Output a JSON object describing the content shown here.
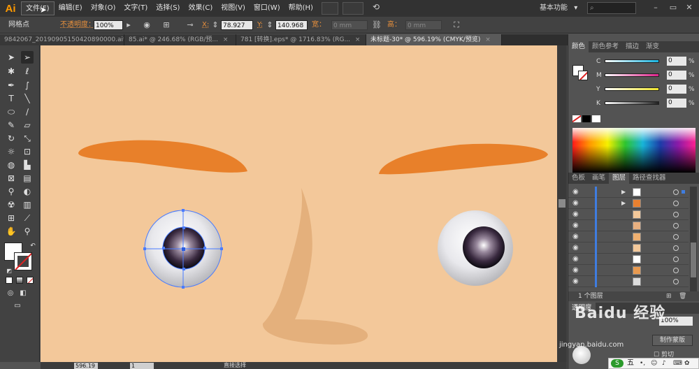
{
  "app": {
    "logo": "Ai"
  },
  "menu": {
    "items": [
      "文件(F)",
      "编辑(E)",
      "对象(O)",
      "文字(T)",
      "选择(S)",
      "效果(C)",
      "视图(V)",
      "窗口(W)",
      "帮助(H)"
    ],
    "workspace": "基本功能",
    "workspace_arrow": "▾"
  },
  "control": {
    "selection_label": "网格点",
    "opacity_label": "不透明度：",
    "opacity_value": "100%",
    "x_label": "X:",
    "x_value": "78.927",
    "y_label": "Y:",
    "y_value": "140.968",
    "width_label": "宽：",
    "width_value": "0 mm",
    "height_label": "高：",
    "height_value": "0 mm"
  },
  "tabs": [
    {
      "label": "9842067_20190905150420890000.ai*",
      "active": false
    },
    {
      "label": "85.ai* @ 246.68% (RGB/预...",
      "active": false
    },
    {
      "label": "781 [转换].eps* @ 1716.83% (RG...",
      "active": false
    },
    {
      "label": "未标题-30* @ 596.19% (CMYK/预览)",
      "active": true
    }
  ],
  "color_panel": {
    "tabs": [
      "颜色",
      "颜色参考",
      "描边",
      "渐变"
    ],
    "channels": [
      {
        "label": "C",
        "value": "0",
        "unit": "%",
        "color": "#19b5e0"
      },
      {
        "label": "M",
        "value": "0",
        "unit": "%",
        "color": "#e0238c"
      },
      {
        "label": "Y",
        "value": "0",
        "unit": "%",
        "color": "#f0e62d"
      },
      {
        "label": "K",
        "value": "0",
        "unit": "%",
        "color": "#222222"
      }
    ]
  },
  "layers_panel": {
    "tabs": [
      "色板",
      "画笔",
      "图层",
      "路径查找器"
    ],
    "count_label": "1 个图层",
    "rows": [
      {
        "arrow": "▶",
        "thumb": "#ffffff",
        "selected": true
      },
      {
        "arrow": "▶",
        "thumb": "#e88030",
        "selected": false
      },
      {
        "arrow": "",
        "thumb": "#f3c89a",
        "selected": false
      },
      {
        "arrow": "",
        "thumb": "#e8b080",
        "selected": false
      },
      {
        "arrow": "",
        "thumb": "#f0b070",
        "selected": false
      },
      {
        "arrow": "",
        "thumb": "#f3c89a",
        "selected": false
      },
      {
        "arrow": "",
        "thumb": "#ffffff",
        "selected": false
      },
      {
        "arrow": "",
        "thumb": "#e89a50",
        "selected": false
      },
      {
        "arrow": "",
        "thumb": "#dddddd",
        "selected": false
      }
    ]
  },
  "lower_panel": {
    "tab_label": "透明度",
    "opacity_value": "100%",
    "mask_button": "制作蒙版",
    "clip_label": "剪切"
  },
  "status": {
    "zoom": "596.19",
    "page": "1",
    "tool_name": "直接选择"
  },
  "watermark": {
    "text1": "Baidu 经验",
    "text2": "jingyan.baidu.com"
  },
  "ime": {
    "label": "五"
  },
  "colors": {
    "canvas_bg": "#f3c89a",
    "eyebrow": "#e8802a",
    "nose": "#e4b07c"
  }
}
